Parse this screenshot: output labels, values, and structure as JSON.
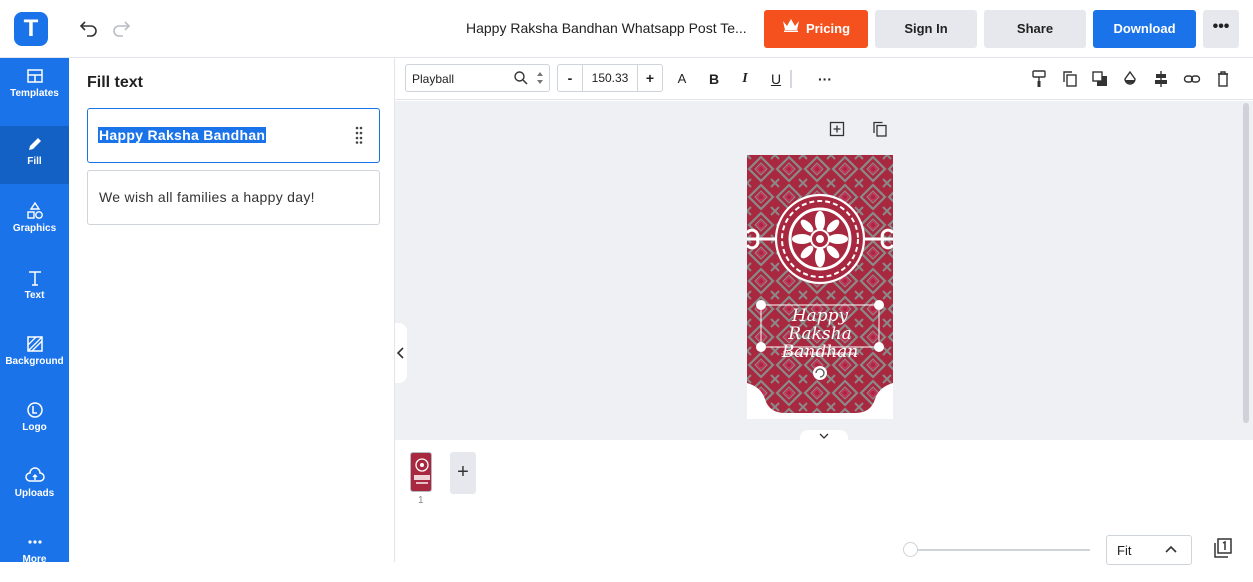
{
  "app": {
    "logo_letter": "T"
  },
  "header": {
    "document_title": "Happy Raksha Bandhan Whatsapp Post Te...",
    "pricing_label": "Pricing",
    "signin_label": "Sign In",
    "share_label": "Share",
    "download_label": "Download",
    "more_label": "•••"
  },
  "sidebar": {
    "items": [
      {
        "label": "Templates",
        "icon": "templates-icon"
      },
      {
        "label": "Fill",
        "icon": "pencil-icon",
        "active": true
      },
      {
        "label": "Graphics",
        "icon": "shapes-icon"
      },
      {
        "label": "Text",
        "icon": "text-icon"
      },
      {
        "label": "Background",
        "icon": "background-icon"
      },
      {
        "label": "Logo",
        "icon": "logo-icon"
      },
      {
        "label": "Uploads",
        "icon": "upload-cloud-icon"
      },
      {
        "label": "More",
        "icon": "more-icon"
      }
    ]
  },
  "panel": {
    "title": "Fill text",
    "fields": [
      {
        "value": "Happy Raksha Bandhan",
        "selected": true
      },
      {
        "value": "We wish all families a happy day!"
      }
    ]
  },
  "toolbar": {
    "font_name": "Playball",
    "font_size": "150.33",
    "minus_label": "-",
    "plus_label": "+",
    "case_label": "A",
    "bold_label": "B",
    "italic_label": "I",
    "underline_label": "U",
    "more_label": "···"
  },
  "canvas": {
    "card_title_line1": "Happy Raksha",
    "card_title_line2": "Bandhan",
    "card_subtitle": "We wish all families a happy day!",
    "colors": {
      "primary": "#a8283f",
      "pattern": "#8a8a8a",
      "accent": "#1a73e8",
      "orange": "#f4511e"
    }
  },
  "pages": {
    "items": [
      {
        "number": "1"
      }
    ],
    "add_label": "+"
  },
  "zoom": {
    "label": "Fit",
    "level": 0
  }
}
